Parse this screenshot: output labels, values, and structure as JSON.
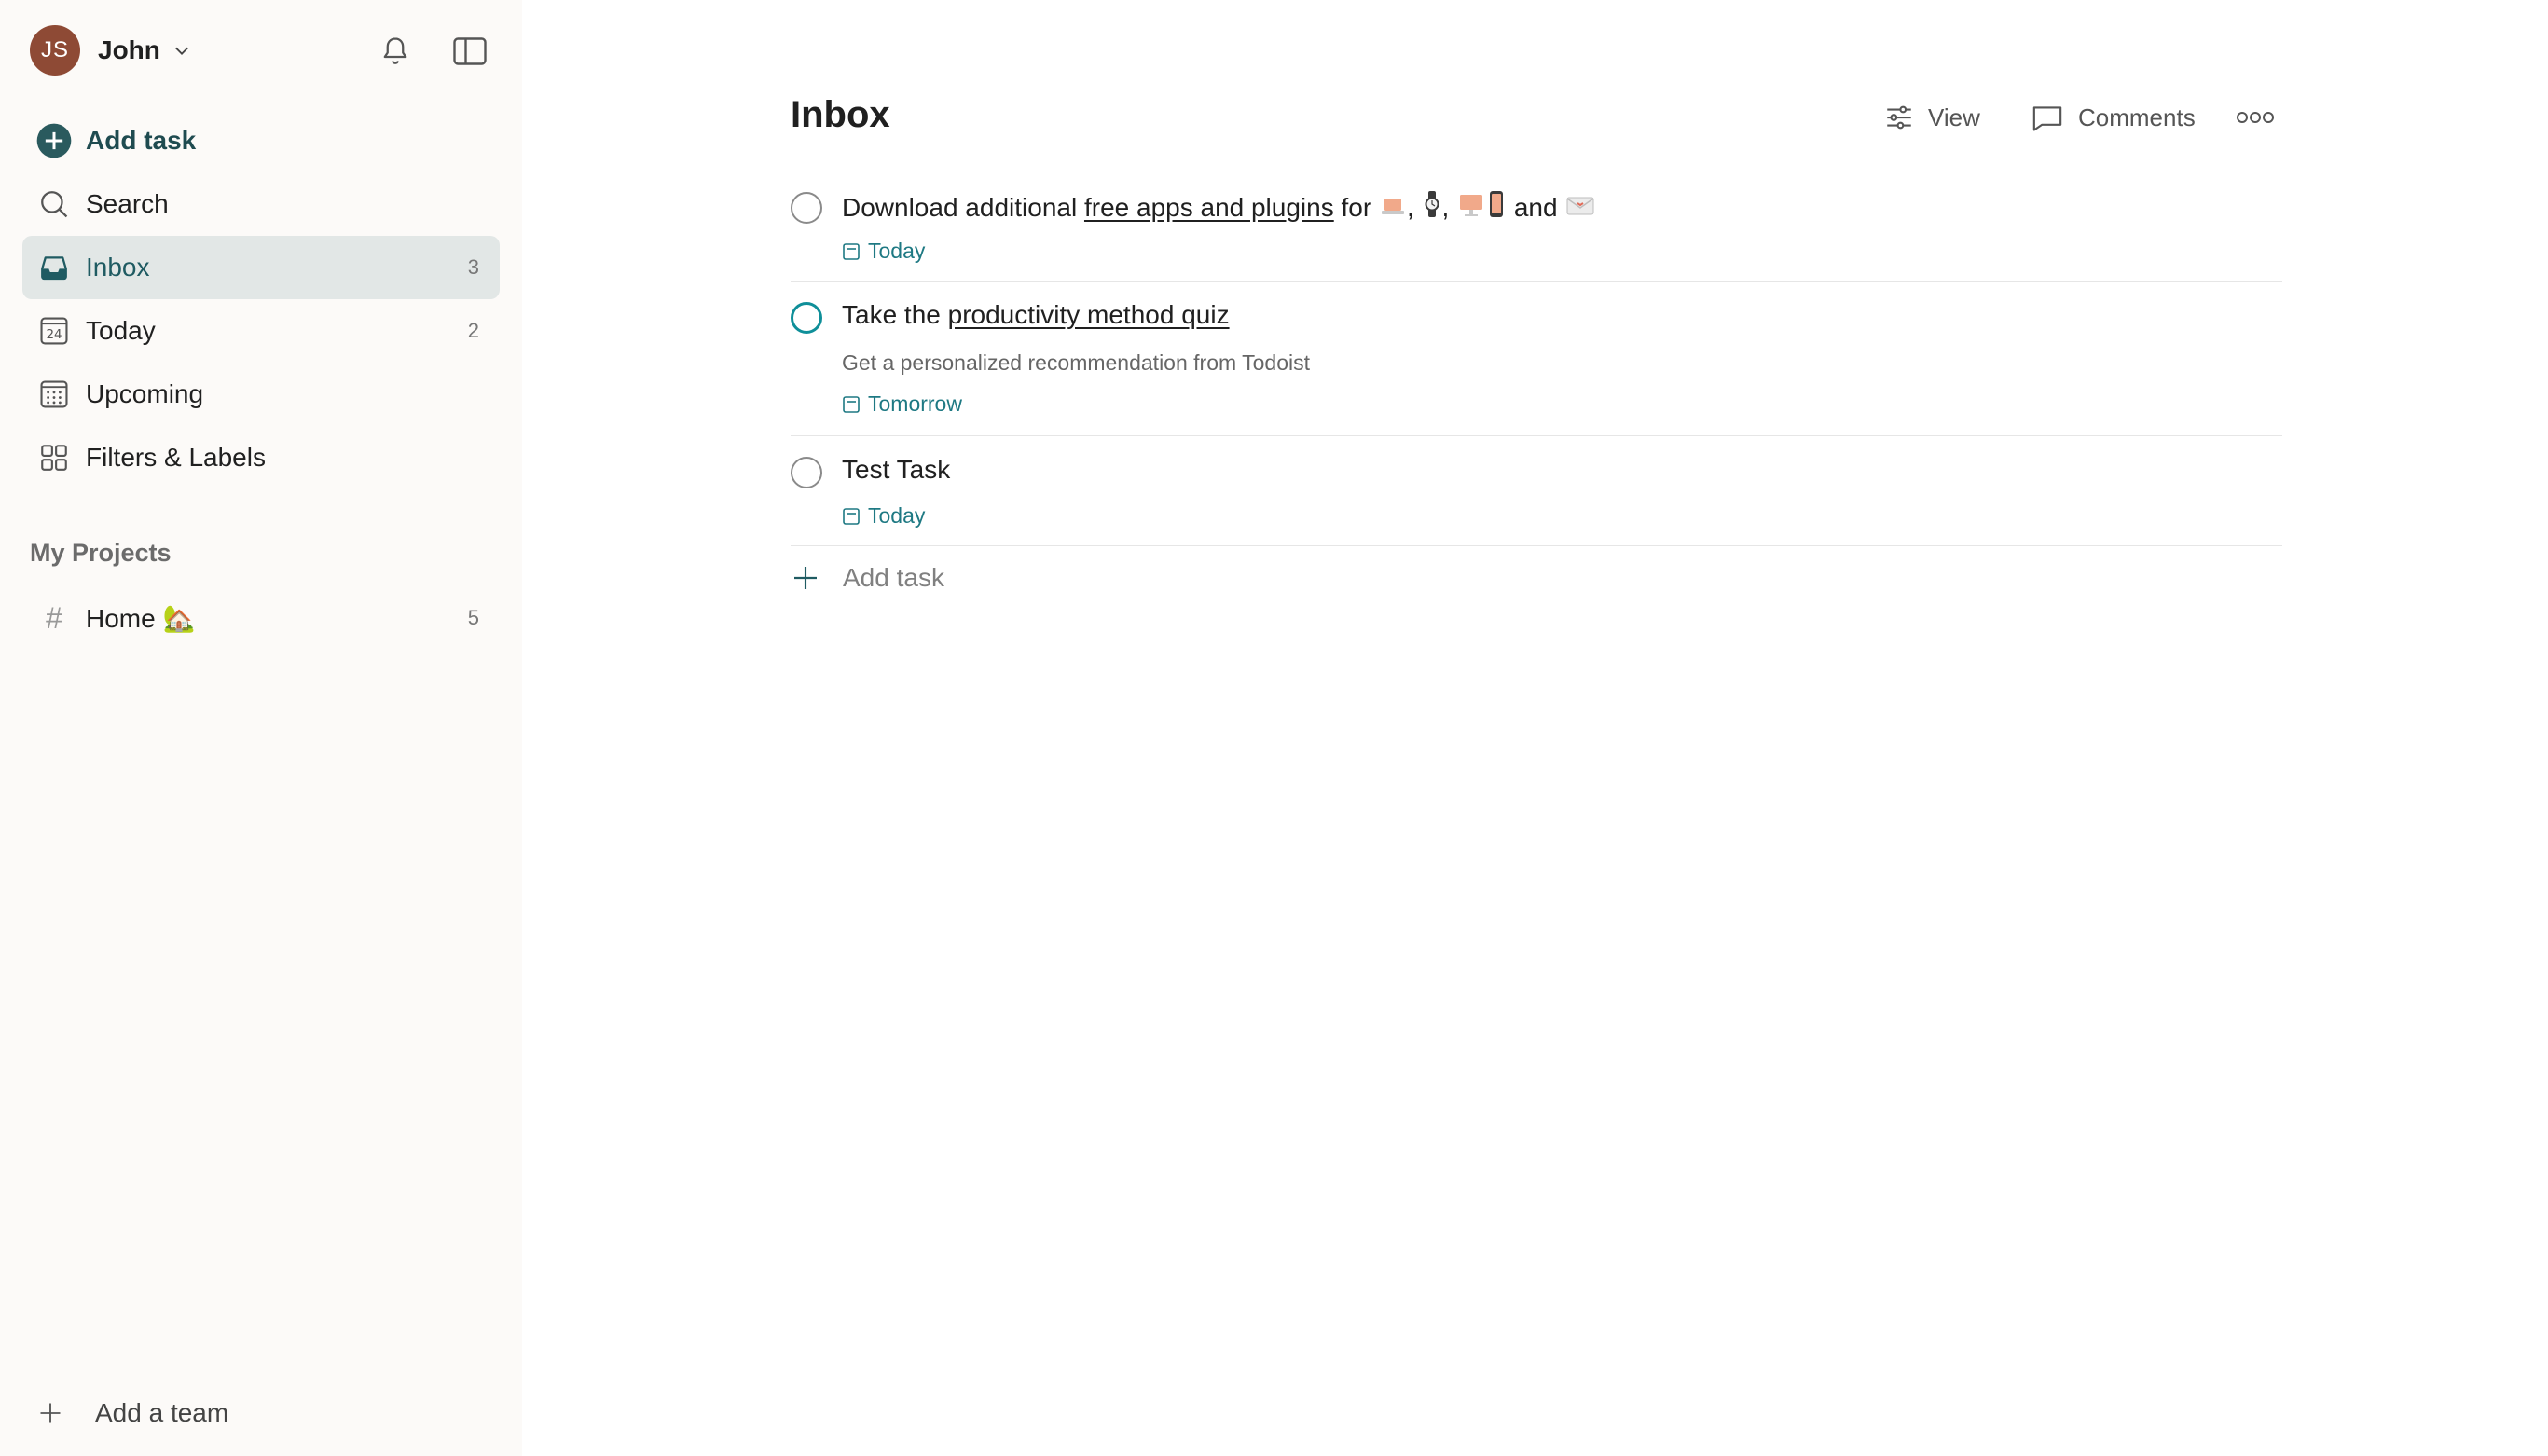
{
  "sidebar": {
    "user": {
      "initials": "JS",
      "name": "John"
    },
    "add_task": "Add task",
    "search": "Search",
    "inbox": {
      "label": "Inbox",
      "count": "3"
    },
    "today": {
      "label": "Today",
      "count": "2",
      "icon_day": "24"
    },
    "upcoming": {
      "label": "Upcoming"
    },
    "filters": {
      "label": "Filters & Labels"
    },
    "projects_title": "My Projects",
    "projects": [
      {
        "hash": "#",
        "name": "Home 🏡",
        "count": "5"
      }
    ],
    "add_team": "Add a team"
  },
  "main": {
    "title": "Inbox",
    "toolbar": {
      "view": "View",
      "comments": "Comments"
    },
    "tasks": [
      {
        "parts": [
          "Download additional ",
          "free apps and plugins",
          " for ",
          ", ",
          ", ",
          " and "
        ],
        "due": "Today"
      },
      {
        "parts": [
          "Take the ",
          "productivity method quiz"
        ],
        "description": "Get a personalized recommendation from Todoist",
        "due": "Tomorrow"
      },
      {
        "parts": [
          "Test Task"
        ],
        "due": "Today"
      }
    ],
    "add_task": "Add task"
  },
  "colors": {
    "accent": "#1f5b62",
    "avatar": "#8e4a35",
    "due": "#1e7983",
    "active_nav_bg": "#e2e7e6"
  },
  "icons": [
    "chevron-down-icon",
    "bell-icon",
    "sidebar-toggle-icon",
    "plus-circle-icon",
    "search-icon",
    "inbox-icon",
    "calendar-today-icon",
    "calendar-grid-icon",
    "filters-grid-icon",
    "hash-icon",
    "plus-icon",
    "view-settings-icon",
    "comment-icon",
    "more-icon",
    "calendar-small-icon",
    "laptop-emoji",
    "watch-emoji",
    "desktop-emoji",
    "phone-emoji",
    "envelope-emoji"
  ]
}
